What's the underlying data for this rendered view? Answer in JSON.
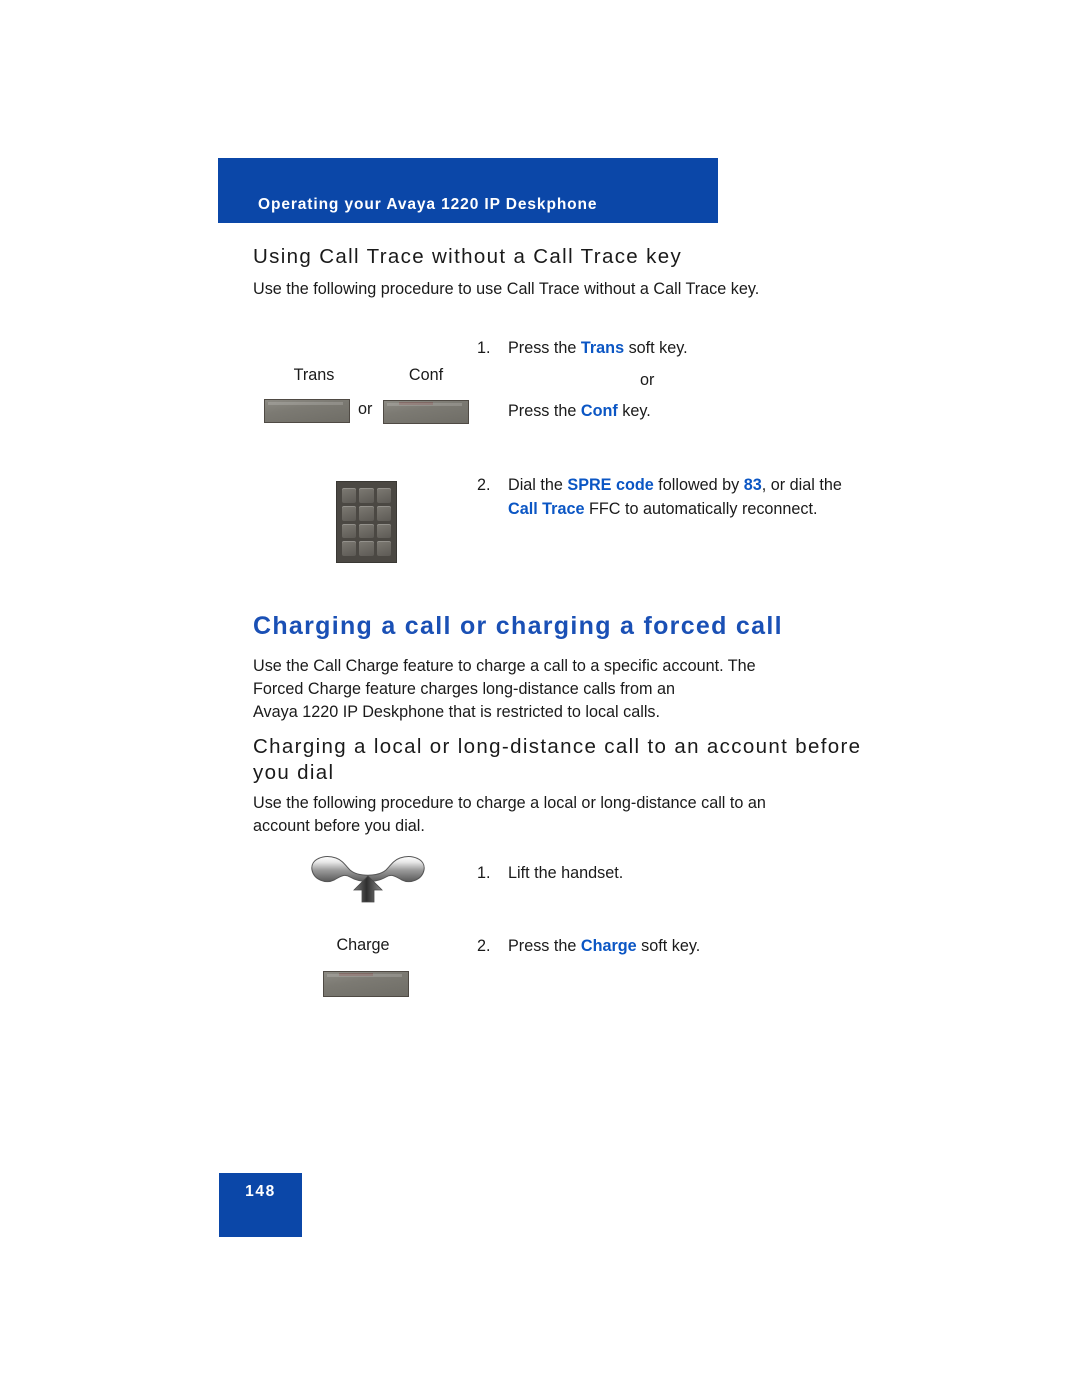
{
  "document": {
    "page_number": "148",
    "accent_blue": "#0B47A8",
    "keyword_blue": "#0b56c4",
    "heading_blue": "#1a50b5"
  },
  "header": {
    "banner_title": "Operating your Avaya 1220 IP Deskphone"
  },
  "section_call_trace": {
    "heading": "Using Call Trace without a Call Trace key",
    "intro": "Use the following procedure to use Call Trace without a Call Trace key.",
    "steps": [
      {
        "number": "1.",
        "line1_pre": "Press the ",
        "line1_kw": "Trans",
        "line1_post": " soft key.",
        "or": "or",
        "line2_pre": "Press the ",
        "line2_kw": "Conf",
        "line2_post": " key."
      },
      {
        "number": "2.",
        "t1": "Dial the ",
        "kw1": "SPRE code",
        "t2": " followed by ",
        "kw2": "83",
        "t3": ", or",
        "t4": "dial the ",
        "kw3": "Call Trace",
        "t5": " FFC to automatically",
        "t6": "reconnect."
      }
    ],
    "icons": {
      "trans_label": "Trans",
      "conf_label": "Conf",
      "between_keys_or": "or",
      "keypad_name": "dialpad-icon"
    }
  },
  "section_charging": {
    "heading": "Charging a call or charging a forced call",
    "paragraph_lines": [
      "Use the Call Charge feature to charge a call to a specific account. The",
      "Forced Charge feature charges long-distance calls from an",
      "Avaya 1220 IP Deskphone that is restricted to local calls."
    ],
    "subheading_lines": [
      "Charging a local or long-distance call to an account before",
      "you dial"
    ],
    "intro_lines": [
      "Use the following procedure to charge a local or long-distance call to an",
      "account before you dial."
    ],
    "steps": [
      {
        "number": "1.",
        "text": "Lift the handset."
      },
      {
        "number": "2.",
        "pre": "Press the ",
        "kw": "Charge",
        "post": " soft key."
      }
    ],
    "icons": {
      "handset_name": "handset-lift-icon",
      "charge_label": "Charge"
    }
  }
}
